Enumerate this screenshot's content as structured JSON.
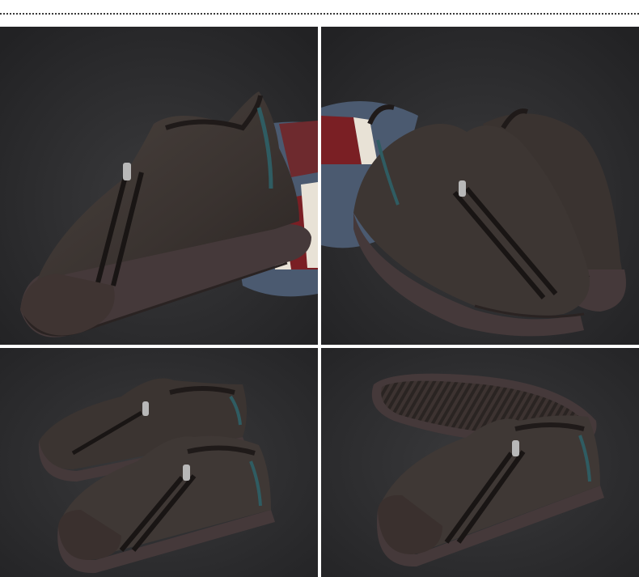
{
  "gallery": {
    "background_color": "#ffffff",
    "panel_background": "#2a2a2c",
    "leather_color": "#3d3633",
    "sole_color": "#4a3c36",
    "accent_colors": {
      "pillow_red": "#7a1f24",
      "pillow_blue": "#4b5a70",
      "pillow_white": "#e8e2d6",
      "heel_iridescent": "#2f5c62"
    },
    "panels": [
      {
        "view": "single-shoe-side-view-with-pillow"
      },
      {
        "view": "pair-of-shoes-front-view-with-pillow"
      },
      {
        "view": "pair-of-shoes-side-view"
      },
      {
        "view": "shoe-with-outsole-view"
      }
    ]
  }
}
